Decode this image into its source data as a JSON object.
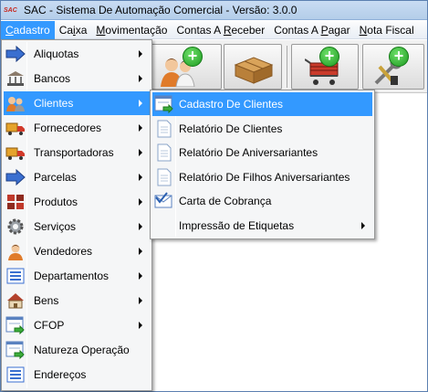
{
  "window": {
    "logo_text": "SAC",
    "title": "SAC - Sistema De Automação Comercial - Versão: 3.0.0"
  },
  "menubar": [
    {
      "pre": "",
      "ul": "C",
      "post": "adastro",
      "active": true
    },
    {
      "pre": "Ca",
      "ul": "i",
      "post": "xa",
      "active": false
    },
    {
      "pre": "",
      "ul": "M",
      "post": "ovimentação",
      "active": false
    },
    {
      "pre": "Contas A ",
      "ul": "R",
      "post": "eceber",
      "active": false
    },
    {
      "pre": "Contas A ",
      "ul": "P",
      "post": "agar",
      "active": false
    },
    {
      "pre": "",
      "ul": "N",
      "post": "ota Fiscal",
      "active": false
    }
  ],
  "cadastro_menu": {
    "items": [
      {
        "label": "Aliquotas",
        "icon": "blue-arrow-icon",
        "submenu": true
      },
      {
        "label": "Bancos",
        "icon": "bank-icon",
        "submenu": true
      },
      {
        "label": "Clientes",
        "icon": "clients-icon",
        "submenu": true,
        "highlighted": true
      },
      {
        "label": "Fornecedores",
        "icon": "truck-icon",
        "submenu": true
      },
      {
        "label": "Transportadoras",
        "icon": "truck-icon",
        "submenu": true
      },
      {
        "label": "Parcelas",
        "icon": "blue-arrow-icon",
        "submenu": true
      },
      {
        "label": "Produtos",
        "icon": "products-icon",
        "submenu": true
      },
      {
        "label": "Serviços",
        "icon": "gear-icon",
        "submenu": true
      },
      {
        "label": "Vendedores",
        "icon": "person-icon",
        "submenu": true
      },
      {
        "label": "Departamentos",
        "icon": "list-icon",
        "submenu": true
      },
      {
        "label": "Bens",
        "icon": "house-icon",
        "submenu": true
      },
      {
        "label": "CFOP",
        "icon": "form-icon",
        "submenu": true
      },
      {
        "label": "Natureza Operação",
        "icon": "form-icon",
        "submenu": false
      },
      {
        "label": "Endereços",
        "icon": "list-icon",
        "submenu": false
      }
    ]
  },
  "clientes_submenu": {
    "items": [
      {
        "label": "Cadastro De Clientes",
        "icon": "form-icon",
        "submenu": false,
        "highlighted": true
      },
      {
        "label": "Relatório De Clientes",
        "icon": "document-icon",
        "submenu": false
      },
      {
        "label": "Relatório De Aniversariantes",
        "icon": "document-icon",
        "submenu": false
      },
      {
        "label": "Relatório De Filhos Aniversariantes",
        "icon": "document-icon",
        "submenu": false
      },
      {
        "label": "Carta de Cobrança",
        "icon": "letter-check-icon",
        "submenu": false
      },
      {
        "label": "Impressão de Etiquetas",
        "icon": "",
        "submenu": true
      }
    ]
  },
  "toolbar": {
    "buttons": [
      {
        "icon": "users-add-icon"
      },
      {
        "icon": "box-icon"
      },
      {
        "icon": "cart-add-icon"
      },
      {
        "icon": "tools-add-icon"
      }
    ],
    "plus_symbol": "+"
  },
  "colors": {
    "highlight": "#3399ff",
    "titlebar": "#c9dcf3",
    "menu_bg": "#f5f6f7"
  }
}
